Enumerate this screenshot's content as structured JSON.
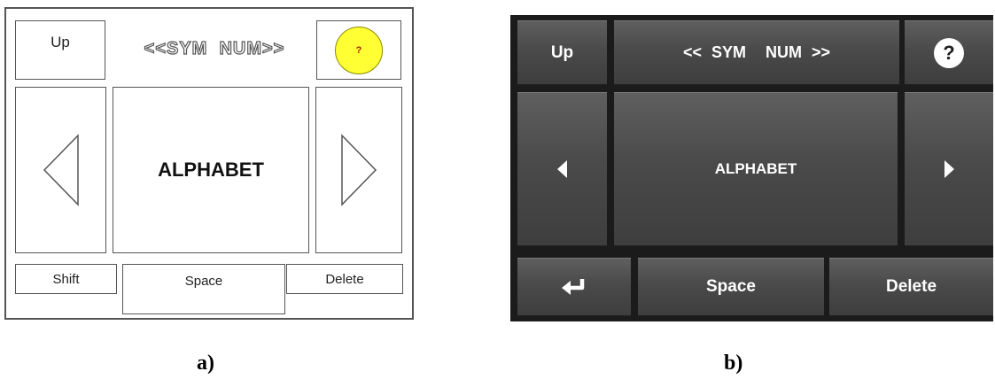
{
  "panel_a": {
    "up_label": "Up",
    "symnum_label": "<<SYM  NUM>>",
    "help_label": "?",
    "center_label": "ALPHABET",
    "shift_label": "Shift",
    "space_label": "Space",
    "delete_label": "Delete",
    "colors": {
      "border": "#555555",
      "help_fill": "#ffff33"
    },
    "icons": {
      "left": "triangle-left-outline-icon",
      "right": "triangle-right-outline-icon"
    }
  },
  "panel_b": {
    "up_label": "Up",
    "symnum_label": "<< SYM  NUM >>",
    "help_label": "?",
    "center_label": "ALPHABET",
    "space_label": "Space",
    "delete_label": "Delete",
    "colors": {
      "background": "#1b1b1b",
      "key": "#4a4a4a",
      "text": "#ffffff"
    },
    "icons": {
      "left": "triangle-left-icon",
      "right": "triangle-right-icon",
      "enter": "enter-return-icon"
    }
  },
  "captions": {
    "a": "a)",
    "b": "b)"
  }
}
